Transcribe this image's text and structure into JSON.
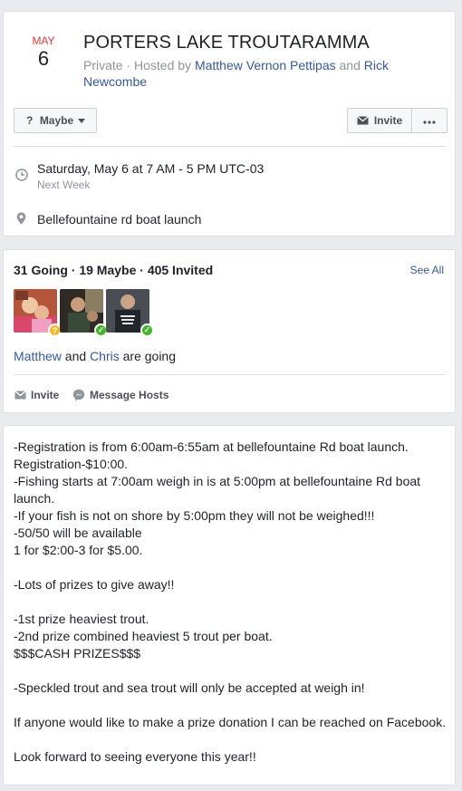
{
  "event": {
    "month": "MAY",
    "day": "6",
    "title": "PORTERS LAKE TROUTARAMMA",
    "privacy": "Private",
    "hosted_by_prefix": " · Hosted by ",
    "host1": "Matthew Vernon Pettipas",
    "host_conj": " and ",
    "host2": "Rick Newcombe",
    "datetime": "Saturday, May 6 at 7 AM - 5 PM UTC-03",
    "relative": "Next Week",
    "location": "Bellefountaine rd boat launch"
  },
  "actions": {
    "maybe_label": "Maybe",
    "maybe_icon": "question-mark-icon",
    "invite_label": "Invite",
    "invite_icon": "envelope-icon",
    "more_icon": "ellipsis-icon"
  },
  "guests": {
    "stats": "31 Going · 19 Maybe · 405 Invited",
    "see_all": "See All",
    "avatars": [
      {
        "status": "maybe",
        "badge": "?",
        "badge_color": "#f7b928"
      },
      {
        "status": "going",
        "badge": "✓",
        "badge_color": "#42b72a"
      },
      {
        "status": "going",
        "badge": "✓",
        "badge_color": "#42b72a"
      }
    ],
    "going_name1": "Matthew",
    "going_conj": " and ",
    "going_name2": "Chris",
    "going_suffix": " are going",
    "invite_label": "Invite",
    "message_label": "Message Hosts"
  },
  "details": {
    "text": "-Registration is from 6:00am-6:55am at bellefountaine Rd boat launch.\nRegistration-$10:00.\n-Fishing starts at 7:00am weigh in is at 5:00pm at bellefountaine Rd boat launch.\n-If your fish is not on shore by 5:00pm they will not be weighed!!!\n-50/50 will be available\n1 for $2:00-3 for $5.00.\n\n-Lots of prizes to give away!!\n\n-1st prize heaviest trout.\n-2nd prize combined heaviest 5 trout per boat.\n$$$CASH PRIZES$$$\n\n-Speckled trout and sea trout will only be accepted at weigh in!\n\nIf anyone would like to make a prize donation I can be reached on Facebook.\n\nLook forward to seeing everyone this year!!"
  },
  "colors": {
    "link": "#365899",
    "month_red": "#e0393e",
    "secondary_text": "#90949c",
    "background": "#e9ebee"
  }
}
